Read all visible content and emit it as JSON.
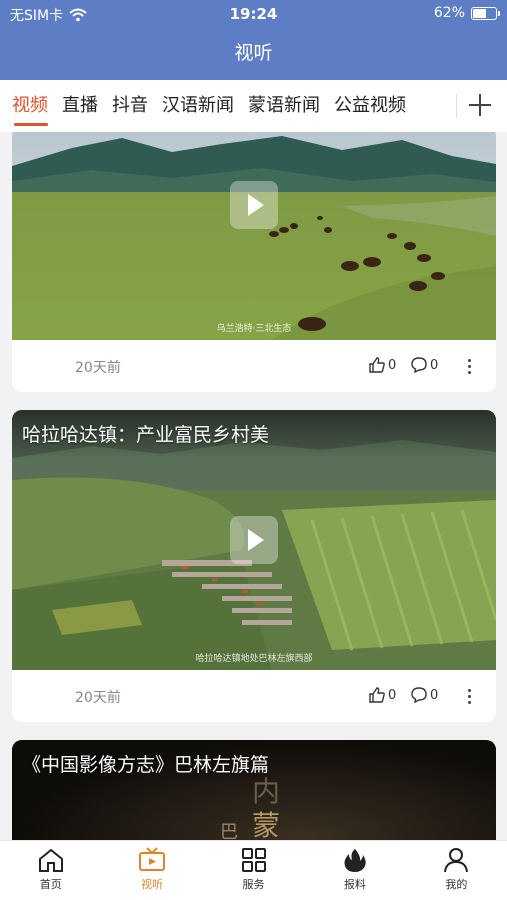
{
  "status": {
    "carrier": "无SIM卡",
    "time": "19:24",
    "battery": "62%",
    "battery_level": 0.62
  },
  "header": {
    "title": "视听"
  },
  "tabs": [
    {
      "label": "视频",
      "active": true
    },
    {
      "label": "直播",
      "active": false
    },
    {
      "label": "抖音",
      "active": false
    },
    {
      "label": "汉语新闻",
      "active": false
    },
    {
      "label": "蒙语新闻",
      "active": false
    },
    {
      "label": "公益视频",
      "active": false
    }
  ],
  "cards": [
    {
      "title": "",
      "caption": "乌兰浩特·三北生态",
      "time": "20天前",
      "likes": "0",
      "comments": "0"
    },
    {
      "title": "哈拉哈达镇：产业富民乡村美",
      "caption": "哈拉哈达镇地处巴林左旗西部",
      "time": "20天前",
      "likes": "0",
      "comments": "0"
    },
    {
      "title": "《中国影像方志》巴林左旗篇",
      "overlay_text": [
        "内",
        "蒙",
        "巴"
      ]
    }
  ],
  "nav": [
    {
      "label": "首页",
      "icon": "home-icon",
      "active": false
    },
    {
      "label": "视听",
      "icon": "tv-icon",
      "active": true
    },
    {
      "label": "服务",
      "icon": "grid-icon",
      "active": false
    },
    {
      "label": "报料",
      "icon": "flame-icon",
      "active": false
    },
    {
      "label": "我的",
      "icon": "person-icon",
      "active": false
    }
  ],
  "colors": {
    "accent": "#e0542b",
    "header": "#5d7ec4",
    "nav_active": "#e0842b"
  }
}
